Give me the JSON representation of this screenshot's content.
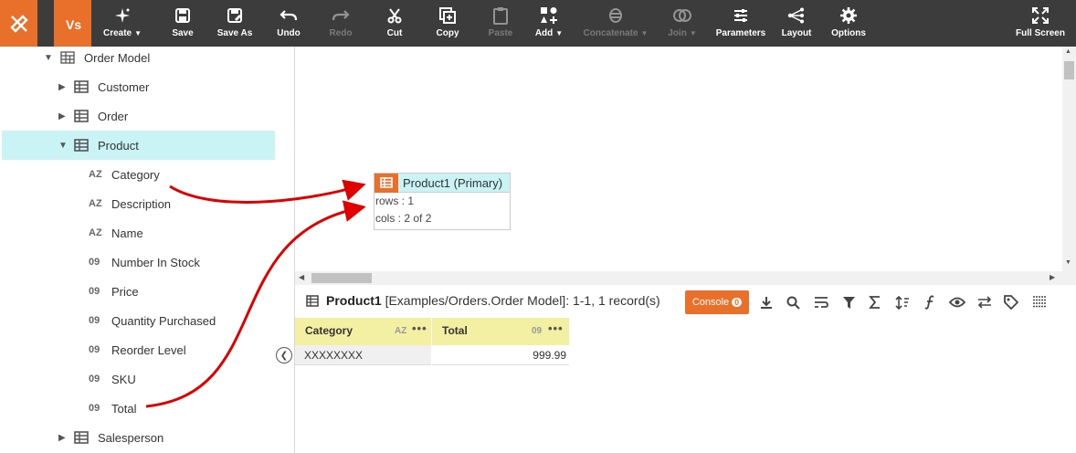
{
  "toolbar": {
    "buttons": [
      {
        "label": "Create",
        "caret": true
      },
      {
        "label": "Save"
      },
      {
        "label": "Save As"
      },
      {
        "label": "Undo"
      },
      {
        "label": "Redo",
        "disabled": true
      },
      {
        "label": "Cut"
      },
      {
        "label": "Copy"
      },
      {
        "label": "Paste",
        "disabled": true
      },
      {
        "label": "Add",
        "caret": true
      },
      {
        "label": "Concatenate",
        "disabled": true,
        "caret": true
      },
      {
        "label": "Join",
        "disabled": true,
        "caret": true
      },
      {
        "label": "Parameters"
      },
      {
        "label": "Layout"
      },
      {
        "label": "Options"
      },
      {
        "label": "Full Screen"
      }
    ],
    "accent": "#e8702a",
    "background": "#3c3c3c"
  },
  "tree": {
    "root": "Order Model",
    "tables": {
      "customer": "Customer",
      "order": "Order",
      "product": "Product",
      "salesperson": "Salesperson"
    },
    "columns": [
      {
        "type": "AZ",
        "label": "Category"
      },
      {
        "type": "AZ",
        "label": "Description"
      },
      {
        "type": "AZ",
        "label": "Name"
      },
      {
        "type": "09",
        "label": "Number In Stock"
      },
      {
        "type": "09",
        "label": "Price"
      },
      {
        "type": "09",
        "label": "Quantity Purchased"
      },
      {
        "type": "09",
        "label": "Reorder Level"
      },
      {
        "type": "09",
        "label": "SKU"
      },
      {
        "type": "09",
        "label": "Total"
      }
    ],
    "selected_color": "#c9f3f5"
  },
  "node": {
    "title": "Product1 (Primary)",
    "rows": "rows : 1",
    "cols": "cols : 2 of 2"
  },
  "panel": {
    "name": "Product1",
    "path": " [Examples/Orders.Order Model]: 1-1, 1 record(s)",
    "console_label": "Console",
    "console_count": "0",
    "columns": [
      {
        "label": "Category",
        "type": "AZ",
        "value": "XXXXXXXX"
      },
      {
        "label": "Total",
        "type": "09",
        "value": "999.99"
      }
    ],
    "header_color": "#f3f0a3"
  },
  "icons": [
    "bridge-logo-icon",
    "vs-logo-icon",
    "wand-icon",
    "save-icon",
    "save-as-icon",
    "undo-icon",
    "redo-icon",
    "scissors-icon",
    "copy-icon",
    "paste-icon",
    "add-shapes-icon",
    "concatenate-icon",
    "join-icon",
    "parameters-icon",
    "layout-icon",
    "gear-icon",
    "fullscreen-icon",
    "table-icon",
    "download-icon",
    "search-icon",
    "wrap-icon",
    "filter-icon",
    "sigma-icon",
    "sort-icon",
    "function-icon",
    "eye-icon",
    "swap-icon",
    "tag-icon",
    "grid-icon",
    "collapse-left-icon"
  ]
}
